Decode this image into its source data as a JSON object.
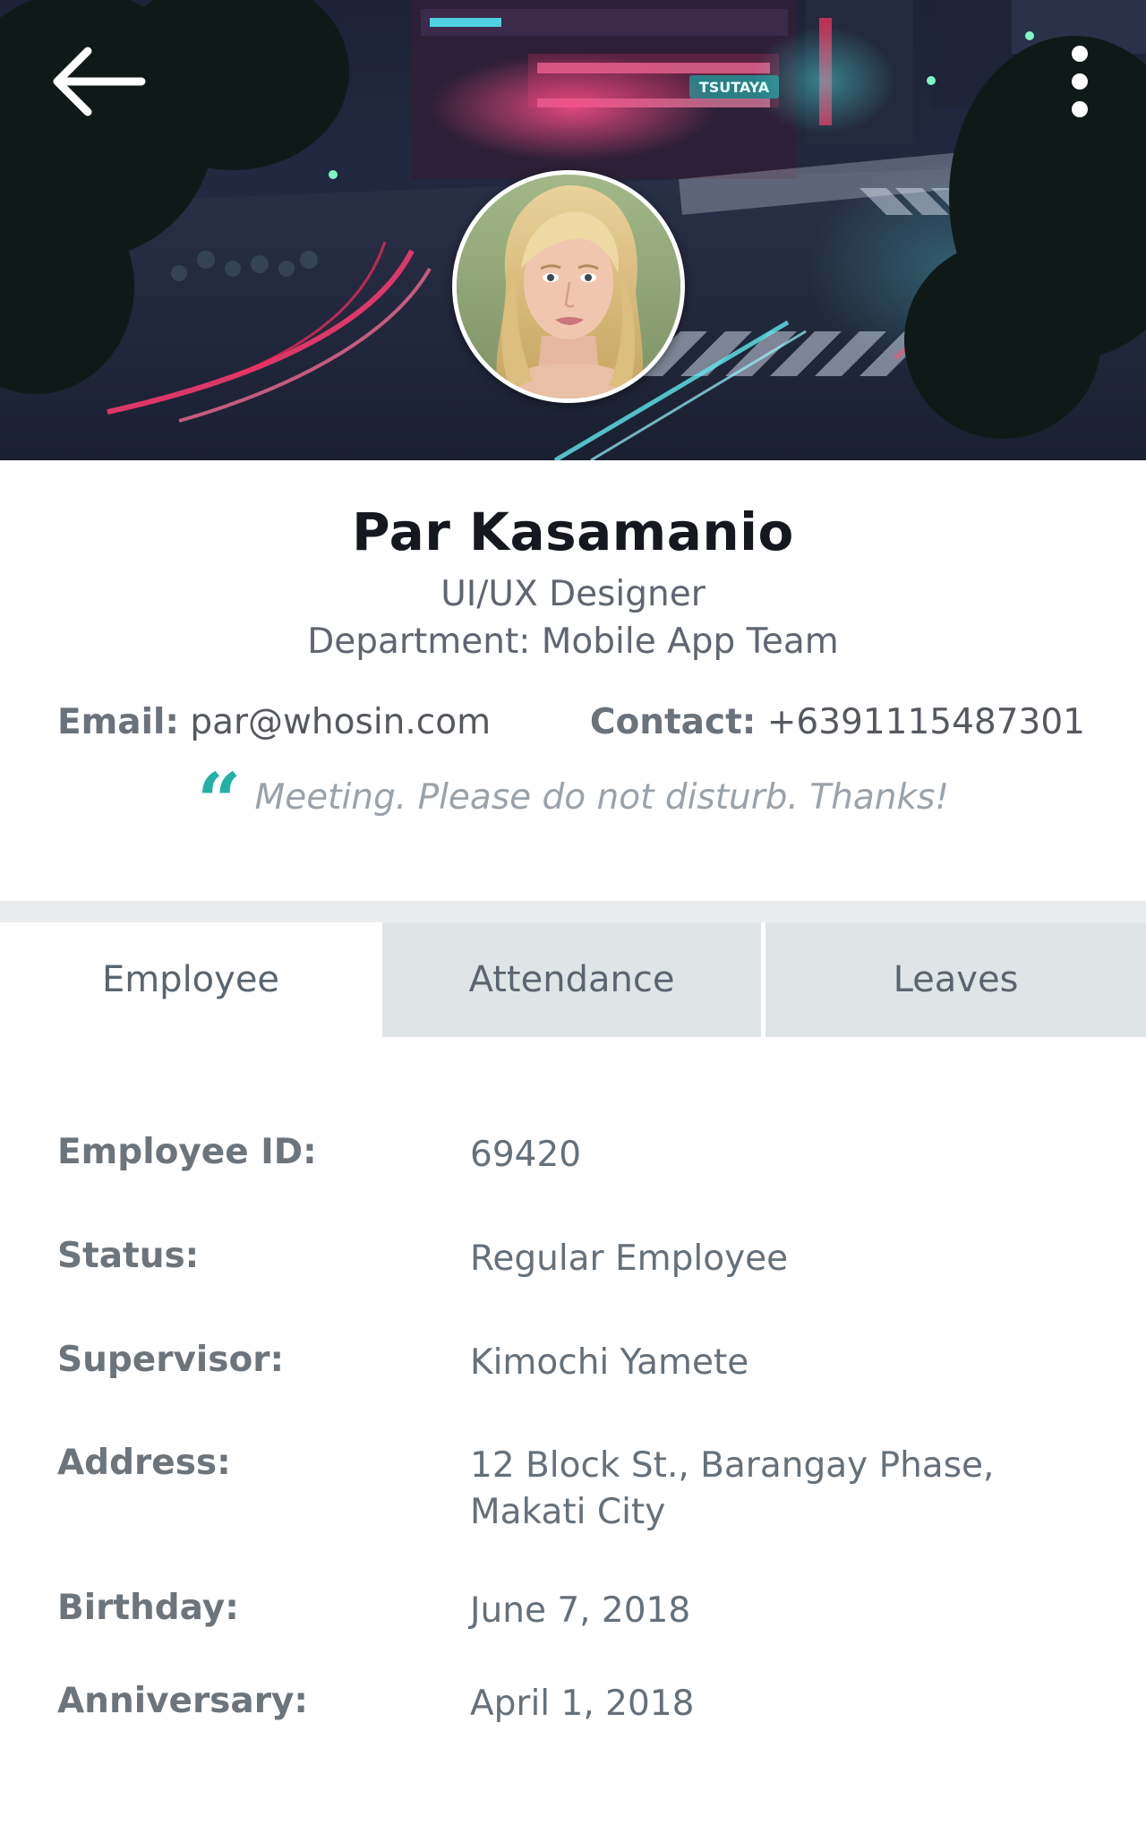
{
  "header": {
    "back_icon": "arrow-left-icon",
    "more_icon": "more-vertical-icon",
    "cover_photo": "city-street-night-photo",
    "cover_sign_text": "TSUTAYA",
    "avatar": "profile-photo"
  },
  "profile": {
    "name": "Par Kasamanio",
    "job_title": "UI/UX Designer",
    "department": "Department: Mobile App Team",
    "email_label": "Email:",
    "email": "par@whosin.com",
    "contact_label": "Contact:",
    "contact": "+6391115487301",
    "status_icon": "quote-icon",
    "status_message": "Meeting. Please do not disturb. Thanks!"
  },
  "tabs": [
    {
      "label": "Employee",
      "active": true
    },
    {
      "label": "Attendance",
      "active": false
    },
    {
      "label": "Leaves",
      "active": false
    }
  ],
  "details": [
    {
      "label": "Employee ID:",
      "value": "69420"
    },
    {
      "label": "Status:",
      "value": "Regular Employee"
    },
    {
      "label": "Supervisor:",
      "value": "Kimochi Yamete"
    },
    {
      "label": "Address:",
      "value": "12 Block St., Barangay Phase, Makati City"
    },
    {
      "label": "Birthday:",
      "value": "June 7, 2018"
    },
    {
      "label": "Anniversary:",
      "value": "April 1, 2018"
    }
  ],
  "colors": {
    "accent": "#23b0a6",
    "inactive_tab": "#dfe5e6",
    "name_text": "#15181f",
    "muted_text": "#6c747c"
  }
}
